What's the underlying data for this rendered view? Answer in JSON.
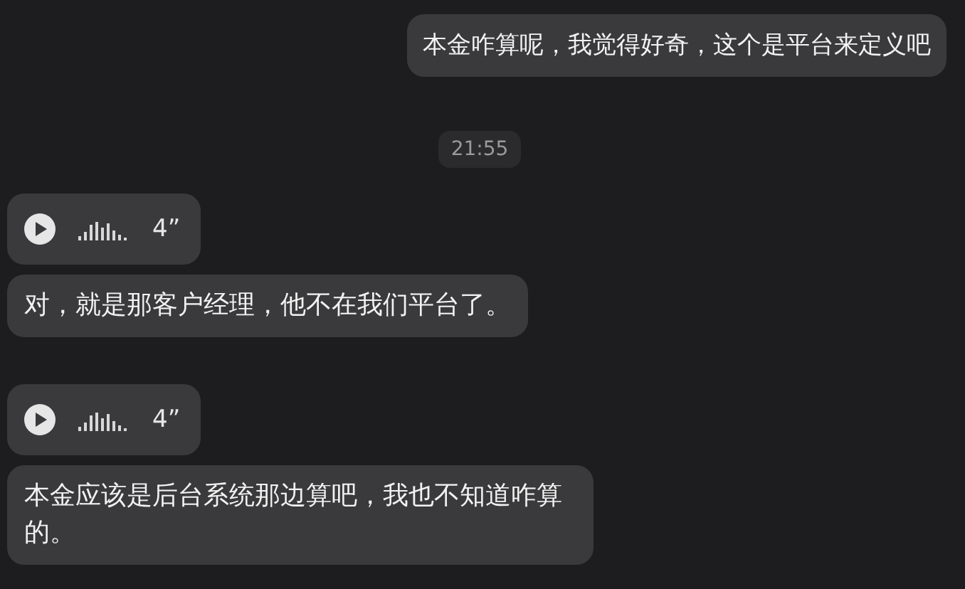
{
  "messages": [
    {
      "kind": "text",
      "outgoing": true,
      "text": "本金咋算呢，我觉得好奇，这个是平台来定义吧"
    },
    {
      "kind": "time",
      "text": "21:55"
    },
    {
      "kind": "voice",
      "outgoing": false,
      "duration": "4”"
    },
    {
      "kind": "text",
      "outgoing": false,
      "text": "对，就是那客户经理，他不在我们平台了。"
    },
    {
      "kind": "voice",
      "outgoing": false,
      "duration": "4”"
    },
    {
      "kind": "text",
      "outgoing": false,
      "text": "本金应该是后台系统那边算吧，我也不知道咋算的。"
    }
  ]
}
